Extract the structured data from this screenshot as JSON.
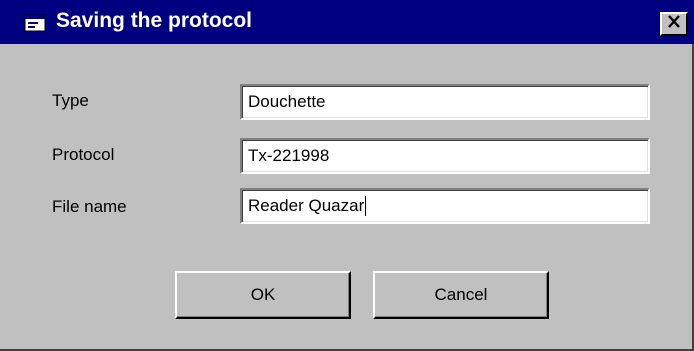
{
  "window": {
    "title": "Saving the protocol",
    "icon": "window-app-icon",
    "close_icon": "close-icon"
  },
  "form": {
    "fields": [
      {
        "label": "Type",
        "value": "Douchette"
      },
      {
        "label": "Protocol",
        "value": "Tx-221998"
      },
      {
        "label": "File name",
        "value": "Reader Quazar"
      }
    ]
  },
  "buttons": {
    "ok_label": "OK",
    "cancel_label": "Cancel"
  },
  "colors": {
    "titlebar": "#000080",
    "face": "#c0c0c0"
  }
}
